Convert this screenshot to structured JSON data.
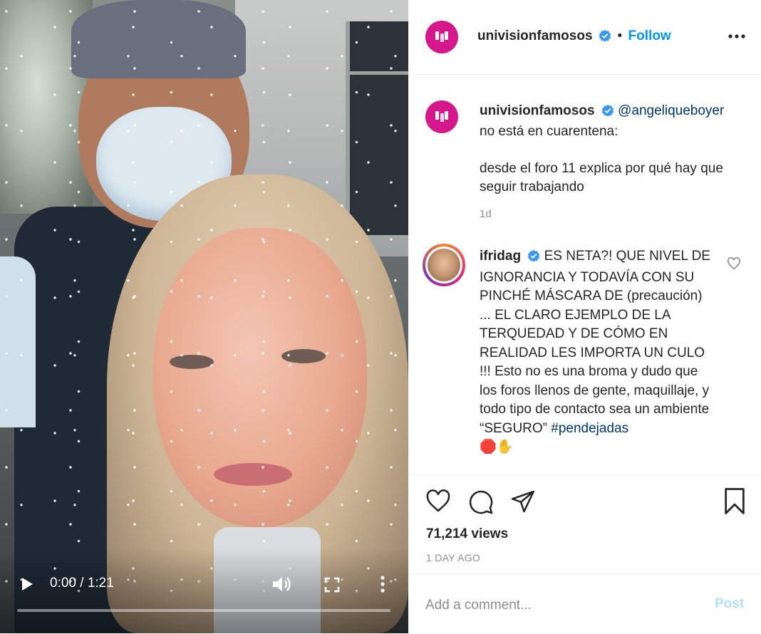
{
  "colors": {
    "brand_avatar": "#d6168b",
    "link_blue": "#0095f6",
    "mention_blue": "#00376b",
    "verified_blue": "#3897f0",
    "muted_text": "#8e8e8e",
    "post_disabled": "#b2dffc"
  },
  "video": {
    "current_time": "0:00",
    "separator": "/",
    "duration": "1:21",
    "progress": 0,
    "controls": {
      "play_icon": "play-icon",
      "volume_icon": "volume-icon",
      "fullscreen_icon": "fullscreen-icon",
      "more_icon": "more-vertical-icon"
    }
  },
  "header": {
    "avatar_glyph": "U",
    "username": "univisionfamosos",
    "verified_icon": "verified-badge-icon",
    "dot": "•",
    "follow_label": "Follow",
    "more_icon": "more-horizontal-icon"
  },
  "caption": {
    "avatar_glyph": "U",
    "username": "univisionfamosos",
    "mention": "@angeliqueboyer",
    "line1": "no está en cuarentena:",
    "line2": "desde el foro 11 explica por qué hay que seguir trabajando",
    "time_ago": "1d"
  },
  "comment": {
    "username": "ifridag",
    "text": "ES NETA?! QUE NIVEL DE IGNORANCIA Y TODAVÍA CON SU PINCHÉ MÁSCARA DE (precaución) ... EL CLARO EJEMPLO DE LA TERQUEDAD Y DE CÓMO EN REALIDAD LES IMPORTA UN CULO !!! Esto no es una broma y dudo que los foros llenos de gente, maquillaje, y todo tipo de contacto sea un ambiente “SEGURO”",
    "hashtag": "#pendejadas",
    "emojis": "🛑✋",
    "like_icon": "heart-outline-icon"
  },
  "actions": {
    "like_icon": "heart-outline-icon",
    "comment_icon": "comment-bubble-icon",
    "share_icon": "paper-plane-icon",
    "save_icon": "bookmark-icon",
    "views": "71,214 views",
    "date": "1 DAY AGO"
  },
  "add_comment": {
    "placeholder": "Add a comment...",
    "post_label": "Post"
  }
}
